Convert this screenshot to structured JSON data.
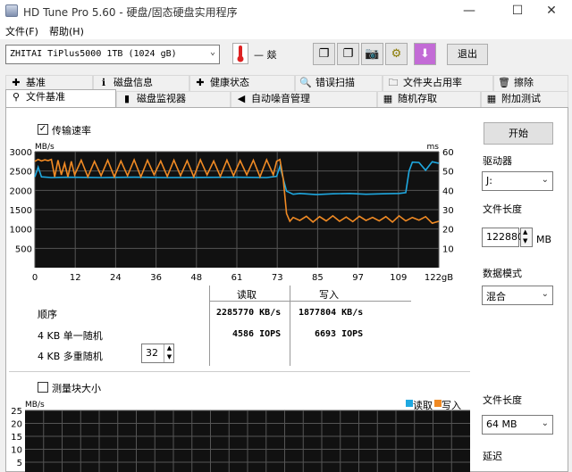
{
  "window": {
    "title": "HD Tune Pro 5.60 - 硬盘/固态硬盘实用程序",
    "minimize": "—",
    "maximize": "☐",
    "close": "✕"
  },
  "menu": [
    {
      "label": "文件(F)"
    },
    {
      "label": "帮助(H)"
    }
  ],
  "toolbar": {
    "drive": "ZHITAI TiPlus5000 1TB (1024 gB)",
    "temperature": "— 燚",
    "exit_label": "退出"
  },
  "tabs_top": [
    {
      "label": "基准",
      "icon": "benchmark-icon",
      "glyph": "✚"
    },
    {
      "label": "磁盘信息",
      "icon": "info-icon",
      "glyph": "ℹ"
    },
    {
      "label": "健康状态",
      "icon": "health-icon",
      "glyph": "✚"
    },
    {
      "label": "错误扫描",
      "icon": "magnifier-icon",
      "glyph": "🔍"
    },
    {
      "label": "文件夹占用率",
      "icon": "folder-icon",
      "glyph": "🗀"
    },
    {
      "label": "擦除",
      "icon": "trash-icon",
      "glyph": "🗑"
    }
  ],
  "tabs_bottom": [
    {
      "label": "文件基准",
      "icon": "file-benchmark-icon",
      "glyph": "⚲"
    },
    {
      "label": "磁盘监视器",
      "icon": "monitor-icon",
      "glyph": "▮"
    },
    {
      "label": "自动噪音管理",
      "icon": "speaker-icon",
      "glyph": "◀"
    },
    {
      "label": "随机存取",
      "icon": "random-icon",
      "glyph": "▦"
    },
    {
      "label": "附加测试",
      "icon": "extra-icon",
      "glyph": "▦"
    }
  ],
  "transfer": {
    "checkbox_label": "传输速率",
    "checked": true,
    "y_left_unit": "MB/s",
    "y_right_unit": "ms",
    "y_left_ticks": [
      "3000",
      "2500",
      "2000",
      "1500",
      "1000",
      "500"
    ],
    "y_right_ticks": [
      "60",
      "50",
      "40",
      "30",
      "20",
      "10"
    ],
    "x_ticks": [
      "0",
      "12",
      "24",
      "36",
      "48",
      "61",
      "73",
      "85",
      "97",
      "109",
      "122gB"
    ]
  },
  "chart_data": {
    "type": "line",
    "x_range": [
      0,
      122
    ],
    "x_unit": "gB",
    "y_left_range": [
      0,
      3000
    ],
    "y_left_unit": "MB/s",
    "y_right_range": [
      0,
      60
    ],
    "y_right_unit": "ms",
    "series": [
      {
        "color": "#1fa8e0",
        "x": [
          0,
          1,
          2,
          5,
          10,
          20,
          30,
          40,
          50,
          60,
          70,
          73,
          74,
          75,
          76,
          78,
          80,
          85,
          90,
          95,
          100,
          105,
          110,
          112,
          113,
          114,
          116,
          118,
          120,
          122
        ],
        "y": [
          2350,
          2600,
          2350,
          2330,
          2340,
          2330,
          2340,
          2330,
          2335,
          2340,
          2330,
          2360,
          2620,
          2300,
          1980,
          1900,
          1920,
          1890,
          1910,
          1920,
          1900,
          1910,
          1920,
          1940,
          2500,
          2730,
          2720,
          2520,
          2740,
          2700
        ]
      },
      {
        "color": "#f08a24",
        "x": [
          0,
          1,
          2,
          3,
          4,
          5,
          6,
          7,
          8,
          9,
          10,
          11,
          12,
          14,
          16,
          18,
          20,
          22,
          24,
          26,
          28,
          30,
          32,
          34,
          36,
          38,
          40,
          42,
          44,
          46,
          48,
          50,
          52,
          54,
          56,
          58,
          60,
          62,
          64,
          66,
          68,
          70,
          72,
          73,
          74,
          75,
          76,
          77,
          78,
          80,
          82,
          84,
          86,
          88,
          90,
          92,
          94,
          96,
          98,
          100,
          102,
          104,
          106,
          108,
          110,
          112,
          114,
          116,
          118,
          120,
          122
        ],
        "y": [
          2750,
          2800,
          2760,
          2790,
          2770,
          2800,
          2350,
          2780,
          2400,
          2700,
          2350,
          2750,
          2400,
          2780,
          2350,
          2750,
          2380,
          2780,
          2350,
          2760,
          2380,
          2790,
          2350,
          2780,
          2400,
          2760,
          2360,
          2780,
          2380,
          2770,
          2350,
          2790,
          2400,
          2760,
          2360,
          2780,
          2380,
          2770,
          2400,
          2780,
          2350,
          2790,
          2400,
          2750,
          2800,
          2300,
          1400,
          1200,
          1300,
          1220,
          1330,
          1180,
          1320,
          1210,
          1340,
          1200,
          1310,
          1190,
          1330,
          1220,
          1300,
          1210,
          1320,
          1180,
          1340,
          1210,
          1300,
          1230,
          1320,
          1150,
          1200
        ]
      }
    ]
  },
  "results": {
    "col_read": "读取",
    "col_write": "写入",
    "rows": [
      {
        "label": "顺序",
        "read": "2285770 KB/s",
        "write": "1877804 KB/s"
      },
      {
        "label": "4 KB 单一随机",
        "read": "4586 IOPS",
        "write": "6693 IOPS"
      },
      {
        "label": "4 KB 多重随机",
        "read": "",
        "write": ""
      }
    ],
    "queue_depth": "32"
  },
  "block": {
    "checkbox_label": "测量块大小",
    "checked": false,
    "y_unit": "MB/s",
    "y_ticks": [
      "25",
      "20",
      "15",
      "10",
      "5"
    ],
    "legend_read": "读取",
    "legend_write": "写入",
    "read_color": "#1fa8e0",
    "write_color": "#f08a24"
  },
  "side": {
    "start_label": "开始",
    "drive_label": "驱动器",
    "drive_value": "J:",
    "file_length_label": "文件长度",
    "file_length_value": "122880",
    "file_length_unit": "MB",
    "data_mode_label": "数据模式",
    "data_mode_value": "混合",
    "file_length2_label": "文件长度",
    "file_length2_value": "64 MB",
    "delay_label": "延迟"
  }
}
